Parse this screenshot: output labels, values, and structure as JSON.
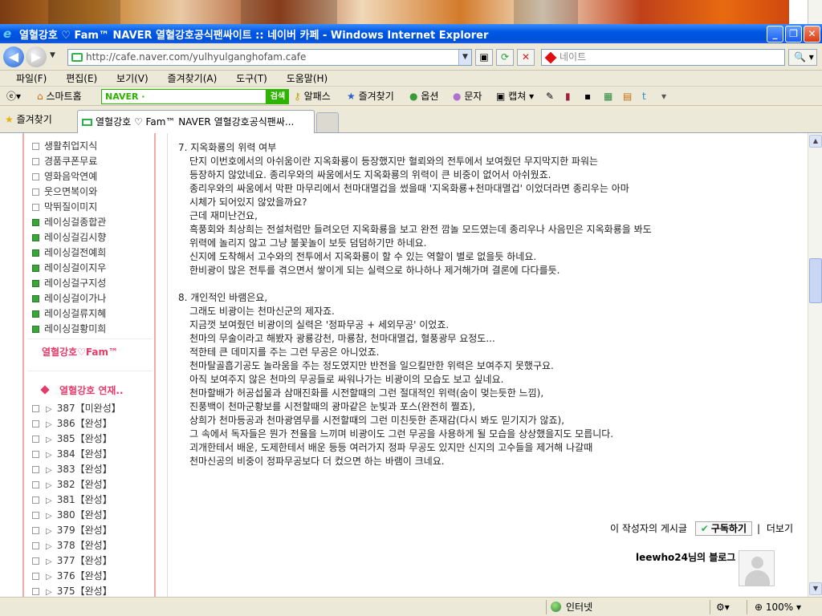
{
  "window": {
    "title": "열혈강호 ♡ Fam™ NAVER 열혈강호공식팬싸이트 :: 네이버 카페 - Windows Internet Explorer",
    "minimize": "_",
    "restore": "❐",
    "close": "✕"
  },
  "address": {
    "url": "http://cafe.naver.com/yulhyulganghofam.cafe",
    "search_placeholder": "네이트"
  },
  "menu": [
    "파일(F)",
    "편집(E)",
    "보기(V)",
    "즐겨찾기(A)",
    "도구(T)",
    "도움말(H)"
  ],
  "toolbar": {
    "smart_home": "스마트홈",
    "naver_label": "NAVER ·",
    "search_button": "검색",
    "alpass": "알패스",
    "favorites": "즐겨찾기",
    "options": "옵션",
    "sms": "문자",
    "capture": "캡쳐"
  },
  "tabs": {
    "favorites": "즐겨찾기",
    "active_tab": "열혈강호 ♡ Fam™ NAVER 열혈강호공식팬싸..."
  },
  "sidebar": {
    "menu_items": [
      {
        "label": "생활취업지식",
        "green": false
      },
      {
        "label": "경품쿠폰무료",
        "green": false
      },
      {
        "label": "영화음악연예",
        "green": false
      },
      {
        "label": "웃으면복이와",
        "green": false
      },
      {
        "label": "막뛰질이미지",
        "green": false
      },
      {
        "label": "레이싱걸종합관",
        "green": true
      },
      {
        "label": "레이싱걸김시향",
        "green": true
      },
      {
        "label": "레이싱걸전예희",
        "green": true
      },
      {
        "label": "레이싱걸이지우",
        "green": true
      },
      {
        "label": "레이싱걸구지성",
        "green": true
      },
      {
        "label": "레이싱걸이가나",
        "green": true
      },
      {
        "label": "레이싱걸류지혜",
        "green": true
      },
      {
        "label": "레이싱걸황미희",
        "green": true
      }
    ],
    "fam_label": "열혈강호♡Fam™",
    "serial_heading": "열혈강호 연재..",
    "episodes": [
      "387【미완성】",
      "386【완성】",
      "385【완성】",
      "384【완성】",
      "383【완성】",
      "382【완성】",
      "381【완성】",
      "380【완성】",
      "379【완성】",
      "378【완성】",
      "377【완성】",
      "376【완성】",
      "375【완성】"
    ]
  },
  "post": {
    "section7": {
      "heading": "7. 지옥화룡의 위력 여부",
      "lines": [
        "단지 이번호에서의 아쉬움이란 지옥화룡이 등장했지만 혈뢰와의 전투에서 보여줬던 무지막지한 파워는",
        "등장하지 않았네요. 종리우와의 싸움에서도 지옥화룡의 위력이 큰 비중이 없어서 아쉬웠죠.",
        "종리우와의 싸움에서 막판 마무리에서 천마대멸겁을 썼을때 '지옥화룡+천마대멸겁' 이었더라면 종리우는 아마",
        "시체가 되어있지 않았을까요?",
        "근데 재미난건요,",
        "흑풍회와 최상희는 전설처럼만 들려오던 지옥화룡을 보고 완전 깜놀 모드였는데 종리우나 사음민은 지옥화룡을 봐도",
        "위력에 놀리지 않고 그냥 불꽃놀이 보듯 덤덤하기만 하네요.",
        "신지에 도착해서 고수와의 전투에서 지옥화룡이 할 수 있는 역할이 별로 없을듯 하네요.",
        "한비광이 많은 전투를 겪으면서 쌓이게 되는 실력으로 하나하나 제거해가며 결론에 다다를듯."
      ]
    },
    "section8": {
      "heading": "8. 개인적인 바램은요,",
      "lines": [
        "그래도 비광이는 천마신군의 제자죠.",
        "지금껏 보여줬던 비광이의 실력은 '정파무공 + 세외무공' 이었죠.",
        "천마의 무술이라고 해봤자 광룡강천, 마룡참, 천마대멸겁, 혈풍광무  요정도...",
        "적한테 큰 데미지를 주는 그런 무공은 아니었죠.",
        "천마탈골흡기공도 놀라움을 주는 정도였지만 반전을 일으킬만한 위력은 보여주지 못했구요.",
        "아직 보여주지 않은 천마의 무공들로 싸워나가는 비광이의 모습도 보고 싶네요.",
        "천마할배가 허공섭물과 삼매진화를 시전할때의 그런 절대적인 위력(숨이 멎는듯한 느낌),",
        "진풍백이 천마군황보를 시전할때의 광마같은 눈빛과 포스(완전히 쩔죠),",
        "상희가 천마등공과 천마광염무를 시전할때의 그런 미친듯한 존재감(다시 봐도 믿기지가 않죠),",
        "그 속에서 독자들은  뭔가 전율을 느끼며 비광이도 그런 무공을 사용하게 될 모습을 상상했을지도 모릅니다.",
        "괴개한테서 배운, 도제한테서 배운 등등 여러가지 정파 무공도 있지만 신지의 고수들을 제거해 나갈때",
        "천마신공의 비중이 정파무공보다 더 컸으면 하는 바램이 크네요."
      ]
    }
  },
  "author": {
    "posts_label": "이 작성자의 게시글",
    "subscribe": "구독하기",
    "more": "더보기",
    "blog": "leewho24님의 블로그"
  },
  "status": {
    "zone": "인터넷",
    "zoom": "100%"
  }
}
